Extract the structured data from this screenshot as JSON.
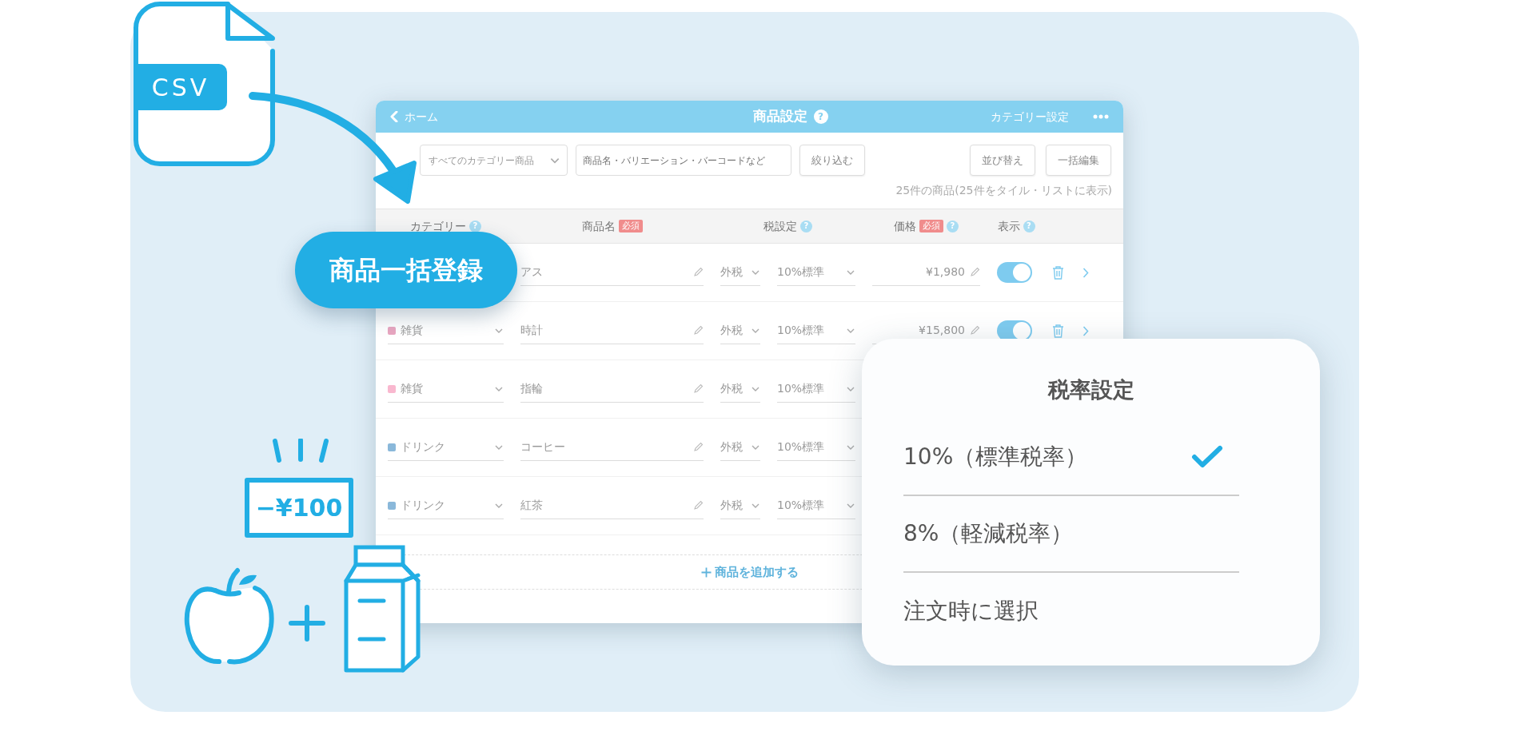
{
  "illustration": {
    "csv_label": "CSV",
    "badge": "商品一括登録",
    "coupon": "−¥100"
  },
  "app": {
    "back": "ホーム",
    "title": "商品設定",
    "title_help": "?",
    "right_link": "カテゴリー設定"
  },
  "toolbar": {
    "category_select": "すべてのカテゴリー商品",
    "search": {
      "placeholder": "商品名・バリエーション・バーコードなど"
    },
    "filter_button": "絞り込む",
    "buttons": [
      "並び替え",
      "一括編集"
    ]
  },
  "count": "25件の商品(25件をタイル・リストに表示)",
  "columns": [
    {
      "label": "カテゴリー",
      "help": "?"
    },
    {
      "label": "商品名",
      "required": "必須"
    },
    {
      "label": "税設定",
      "help": "?"
    },
    {
      "label": "価格",
      "required": "必須",
      "help": "?"
    },
    {
      "label": "表示",
      "help": "?"
    }
  ],
  "rows": [
    {
      "name": "アス",
      "tax_type": "外税",
      "tax_rate": "10%標準",
      "price": "¥1,980",
      "visible": true
    },
    {
      "category": {
        "name": "雑貨",
        "color": "#e8a6c0"
      },
      "name": "時計",
      "tax_type": "外税",
      "tax_rate": "10%標準",
      "price": "¥15,800",
      "visible": true
    },
    {
      "category": {
        "name": "雑貨",
        "color": "#f9b8cf"
      },
      "name": "指輪",
      "tax_type": "外税",
      "tax_rate": "10%標準"
    },
    {
      "category": {
        "name": "ドリンク",
        "color": "#8ab8da"
      },
      "name": "コーヒー",
      "tax_type": "外税",
      "tax_rate": "10%標準"
    },
    {
      "category": {
        "name": "ドリンク",
        "color": "#8ab8da"
      },
      "name": "紅茶",
      "tax_type": "外税",
      "tax_rate": "10%標準"
    }
  ],
  "add_row": "商品を追加する",
  "popup": {
    "title": "税率設定",
    "options": [
      {
        "label": "10%（標準税率）",
        "selected": true
      },
      {
        "label": "8%（軽減税率）",
        "selected": false
      },
      {
        "label": "注文時に選択",
        "selected": false
      }
    ]
  }
}
